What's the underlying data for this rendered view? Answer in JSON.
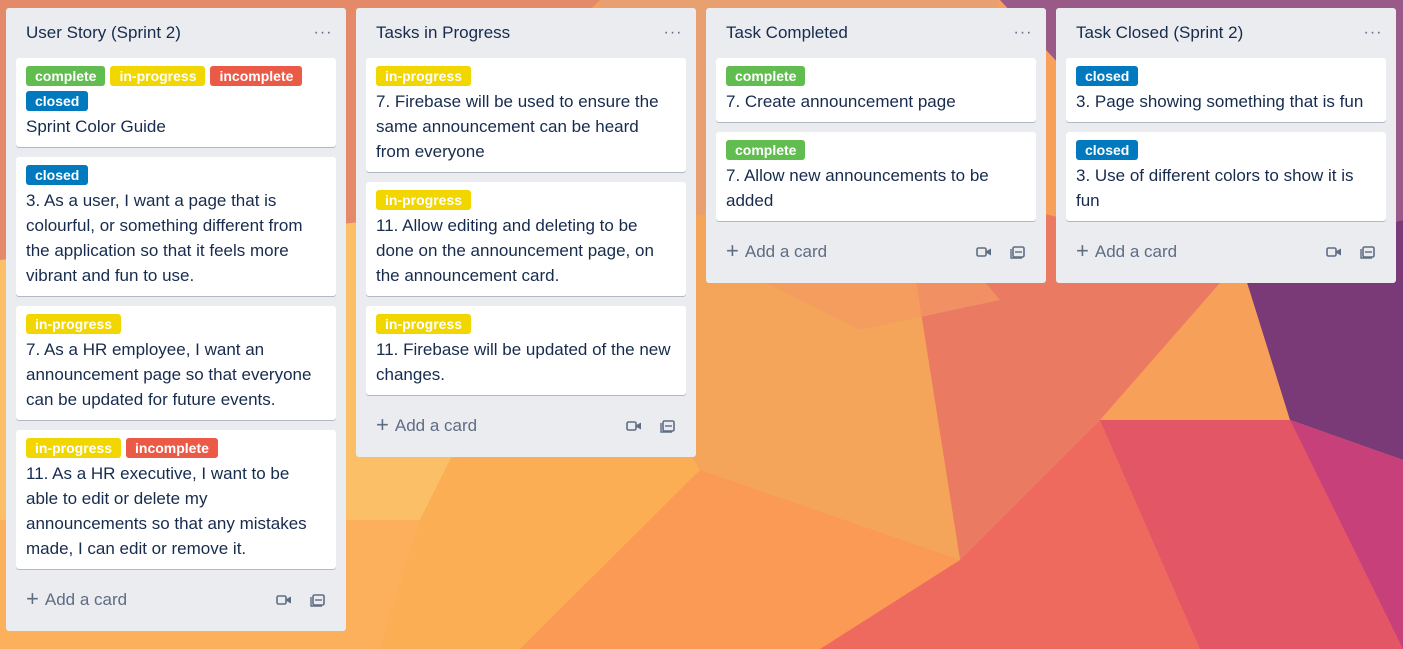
{
  "lists": [
    {
      "title": "User Story (Sprint 2)",
      "menu_glyph": "···",
      "cards": [
        {
          "labels": [
            {
              "text": "complete"
            },
            {
              "text": "in-progress"
            },
            {
              "text": "incomplete"
            },
            {
              "text": "closed"
            }
          ],
          "text": "Sprint Color Guide"
        },
        {
          "labels": [
            {
              "text": "closed"
            }
          ],
          "text": "3. As a user, I want a page that is colourful, or something different from the application so that it feels more vibrant and fun to use."
        },
        {
          "labels": [
            {
              "text": "in-progress"
            }
          ],
          "text": "7. As a HR employee, I want an announcement page so that everyone can be updated for future events."
        },
        {
          "labels": [
            {
              "text": "in-progress"
            },
            {
              "text": "incomplete"
            }
          ],
          "text": "11. As a HR executive, I want to be able to edit or delete my announcements so that any mistakes made, I can edit or remove it."
        }
      ],
      "add_card": "Add a card"
    },
    {
      "title": "Tasks in Progress",
      "menu_glyph": "···",
      "cards": [
        {
          "labels": [
            {
              "text": "in-progress"
            }
          ],
          "text": "7. Firebase will be used to ensure the same announcement can be heard from everyone"
        },
        {
          "labels": [
            {
              "text": "in-progress"
            }
          ],
          "text": "11. Allow editing and deleting to be done on the announcement page, on the announcement card."
        },
        {
          "labels": [
            {
              "text": "in-progress"
            }
          ],
          "text": "11. Firebase will be updated of the new changes."
        }
      ],
      "add_card": "Add a card"
    },
    {
      "title": "Task Completed",
      "menu_glyph": "···",
      "cards": [
        {
          "labels": [
            {
              "text": "complete"
            }
          ],
          "text": "7. Create announcement page"
        },
        {
          "labels": [
            {
              "text": "complete"
            }
          ],
          "text": "7. Allow new announcements to be added"
        }
      ],
      "add_card": "Add a card"
    },
    {
      "title": "Task Closed (Sprint 2)",
      "menu_glyph": "···",
      "cards": [
        {
          "labels": [
            {
              "text": "closed"
            }
          ],
          "text": "3. Page showing something that is fun"
        },
        {
          "labels": [
            {
              "text": "closed"
            }
          ],
          "text": "3. Use of different colors to show it is fun"
        }
      ],
      "add_card": "Add a card"
    }
  ],
  "label_colors": {
    "complete": "#61bd4f",
    "in-progress": "#f2d600",
    "incomplete": "#eb5a46",
    "closed": "#0079bf"
  },
  "add_card_icon": "plus-icon",
  "footer_icons": [
    "video-camera-icon",
    "card-template-icon"
  ]
}
